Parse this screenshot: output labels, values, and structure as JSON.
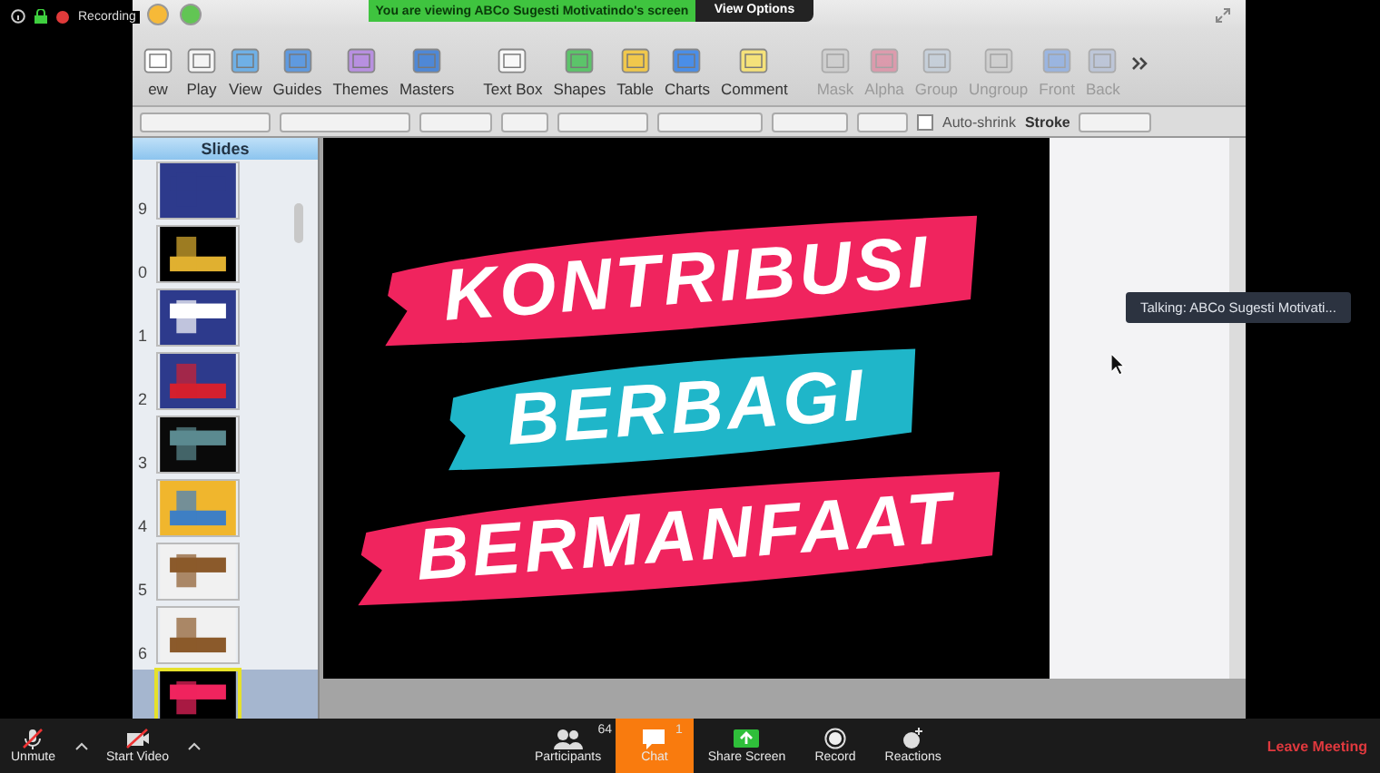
{
  "recording": {
    "label": "Recording"
  },
  "share_banner": {
    "text": "You are viewing ABCo Sugesti Motivatindo's screen",
    "button": "View Options"
  },
  "toolbar": {
    "items": [
      {
        "label": "ew",
        "disabled": false
      },
      {
        "label": "Play",
        "disabled": false
      },
      {
        "label": "View",
        "disabled": false
      },
      {
        "label": "Guides",
        "disabled": false
      },
      {
        "label": "Themes",
        "disabled": false
      },
      {
        "label": "Masters",
        "disabled": false
      },
      {
        "label": "Text Box",
        "disabled": false
      },
      {
        "label": "Shapes",
        "disabled": false
      },
      {
        "label": "Table",
        "disabled": false
      },
      {
        "label": "Charts",
        "disabled": false
      },
      {
        "label": "Comment",
        "disabled": false
      },
      {
        "label": "Mask",
        "disabled": true
      },
      {
        "label": "Alpha",
        "disabled": true
      },
      {
        "label": "Group",
        "disabled": true
      },
      {
        "label": "Ungroup",
        "disabled": true
      },
      {
        "label": "Front",
        "disabled": true
      },
      {
        "label": "Back",
        "disabled": true
      }
    ]
  },
  "format_bar": {
    "auto_shrink": {
      "label": "Auto-shrink",
      "checked": false
    },
    "stroke_label": "Stroke"
  },
  "slides_panel": {
    "title": "Slides",
    "items": [
      {
        "number": "9",
        "selected": false
      },
      {
        "number": "0",
        "selected": false
      },
      {
        "number": "1",
        "selected": false
      },
      {
        "number": "2",
        "selected": false
      },
      {
        "number": "3",
        "selected": false
      },
      {
        "number": "4",
        "selected": false
      },
      {
        "number": "5",
        "selected": false
      },
      {
        "number": "6",
        "selected": false
      },
      {
        "selected": true
      }
    ]
  },
  "slide": {
    "lines": [
      {
        "text": "KONTRIBUSI",
        "color": "#f0245e"
      },
      {
        "text": "BERBAGI",
        "color": "#1fb6c9"
      },
      {
        "text": "BERMANFAAT",
        "color": "#f0245e"
      }
    ]
  },
  "talking": {
    "text": "Talking: ABCo Sugesti Motivati..."
  },
  "meeting_bar": {
    "left": [
      {
        "label": "Unmute",
        "muted": true
      },
      {
        "label": "Start Video",
        "muted": true
      }
    ],
    "center": [
      {
        "label": "Participants",
        "count": "64",
        "selected": false
      },
      {
        "label": "Chat",
        "count": "1",
        "selected": true
      },
      {
        "label": "Share Screen",
        "selected": false
      },
      {
        "label": "Record",
        "selected": false
      },
      {
        "label": "Reactions",
        "selected": false
      }
    ],
    "leave": "Leave Meeting"
  }
}
